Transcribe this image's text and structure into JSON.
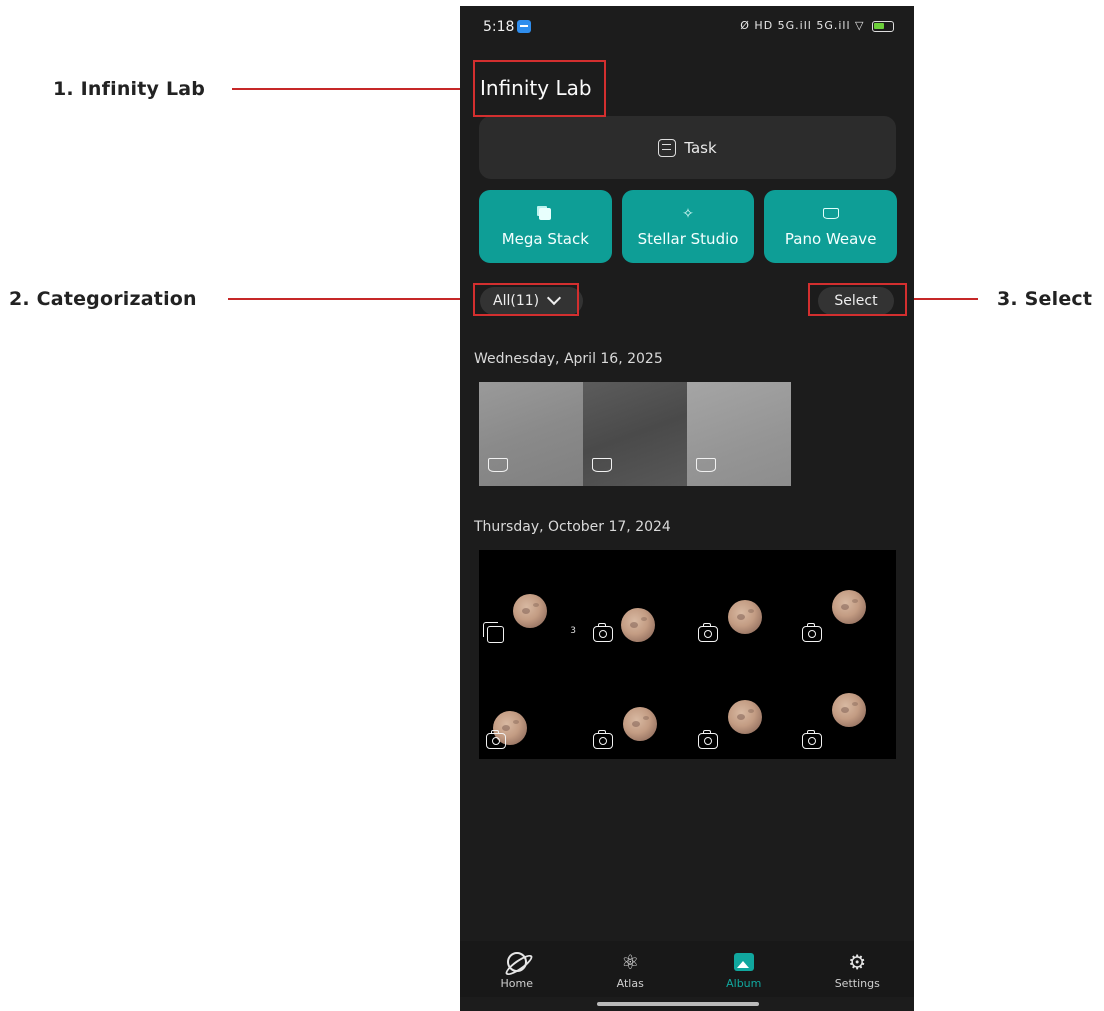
{
  "annotations": {
    "title": "1. Infinity Lab",
    "categorization": "2. Categorization",
    "select": "3. Select",
    "accent_color": "#d32f2f"
  },
  "status_bar": {
    "time": "5:18",
    "icons": "Ø HD 5G.ill 5G.ill ▽"
  },
  "app": {
    "title": "Infinity Lab",
    "task_label": "Task",
    "tools": [
      {
        "label": "Mega Stack",
        "icon": "stack-icon"
      },
      {
        "label": "Stellar Studio",
        "icon": "sparkle-icon"
      },
      {
        "label": "Pano Weave",
        "icon": "panorama-icon"
      }
    ],
    "tool_color": "#0e9e96",
    "category_label": "All(11)",
    "select_label": "Select"
  },
  "groups": [
    {
      "date": "Wednesday, April 16, 2025",
      "items": [
        "panorama",
        "panorama",
        "panorama"
      ]
    },
    {
      "date": "Thursday, October 17, 2024",
      "items": [
        "stack",
        "photo",
        "photo",
        "photo",
        "photo",
        "photo",
        "photo",
        "photo"
      ],
      "stack_count": "3"
    }
  ],
  "nav": {
    "items": [
      {
        "label": "Home",
        "icon": "planet-icon"
      },
      {
        "label": "Atlas",
        "icon": "atlas-icon"
      },
      {
        "label": "Album",
        "icon": "album-icon",
        "active": true
      },
      {
        "label": "Settings",
        "icon": "gear-icon"
      }
    ],
    "active_color": "#11a79e"
  }
}
